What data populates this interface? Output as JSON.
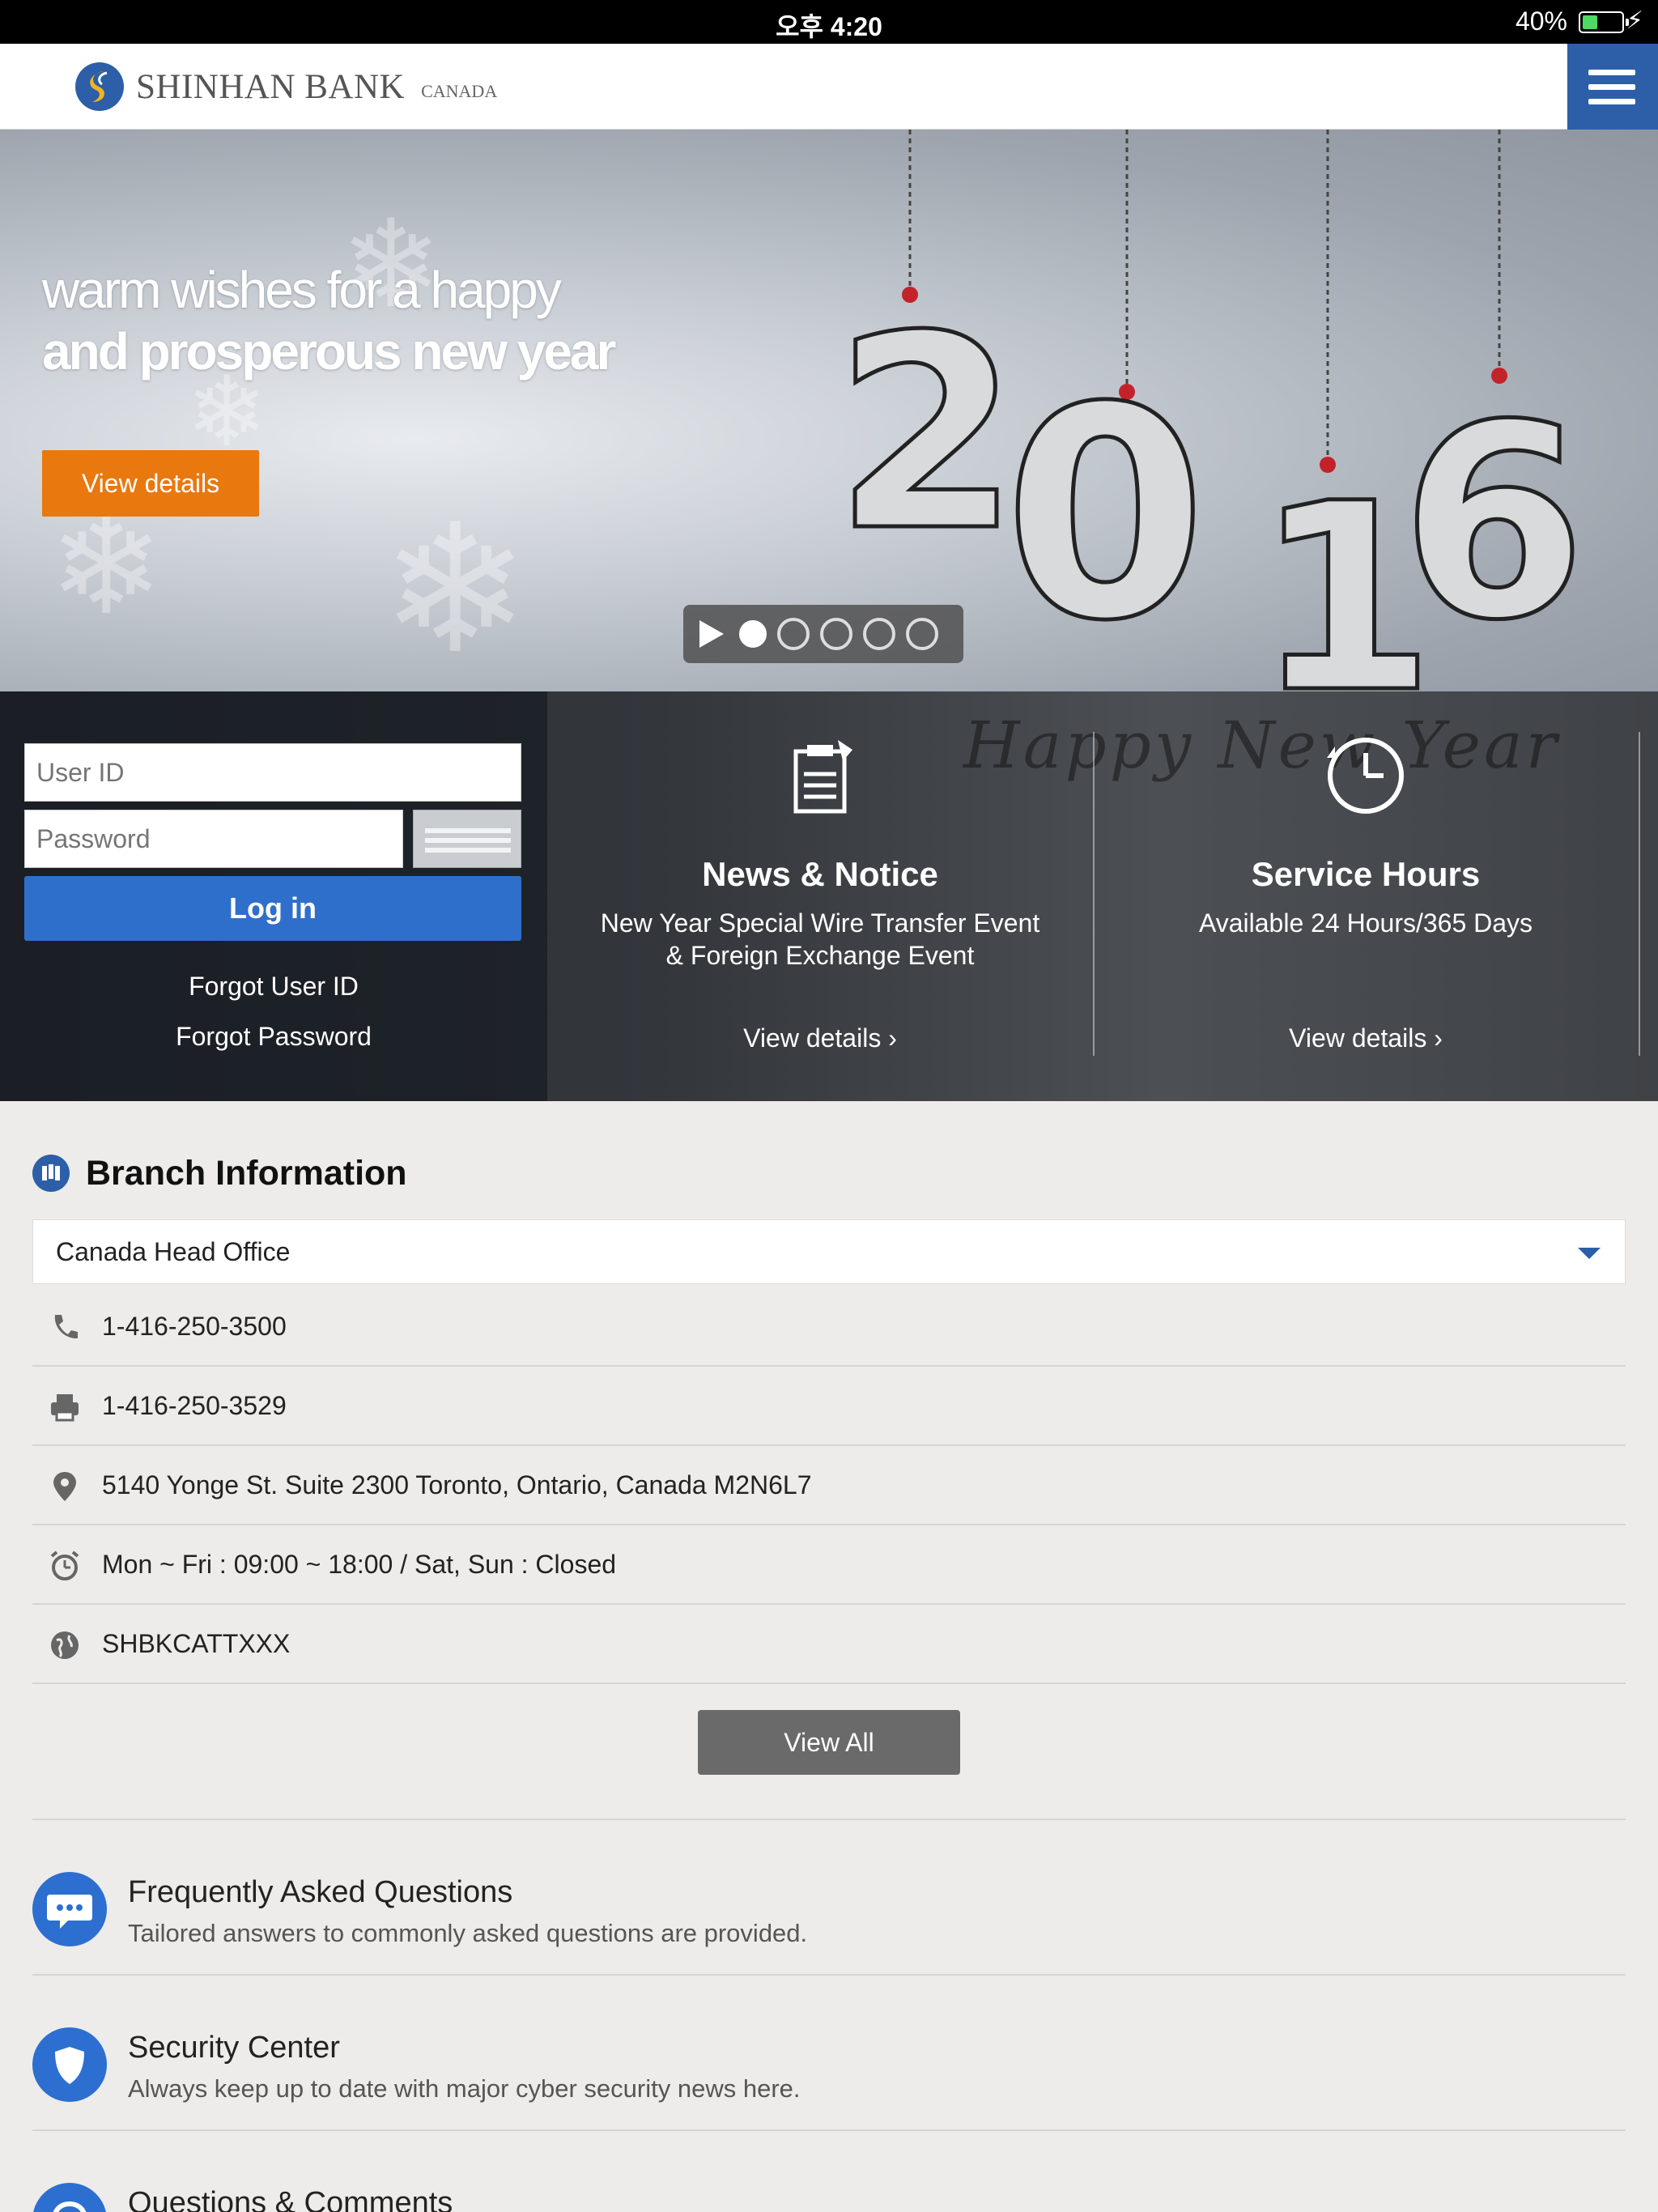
{
  "status_bar": {
    "time": "오후 4:20",
    "battery": "40%",
    "battery_level": 0.4
  },
  "header": {
    "brand": "SHINHAN BANK",
    "brand_suffix": "CANADA",
    "menu_icon": "hamburger-menu-icon"
  },
  "hero": {
    "line1": "warm wishes for a happy",
    "line2": "and prosperous new year",
    "button": "View details",
    "ornament_digits": [
      "2",
      "0",
      "1",
      "6"
    ],
    "slides": 5,
    "active_slide": 1
  },
  "login": {
    "user_placeholder": "User ID",
    "password_placeholder": "Password",
    "login_button": "Log in",
    "forgot_id": "Forgot User ID",
    "forgot_password": "Forgot Password"
  },
  "info_tiles": {
    "background_text": "Happy New Year",
    "news": {
      "title": "News & Notice",
      "line1": "New Year Special Wire Transfer Event",
      "line2": "& Foreign Exchange Event",
      "link": "View details",
      "icon": "clipboard-icon"
    },
    "hours": {
      "title": "Service Hours",
      "line1": "Available 24 Hours/365 Days",
      "link": "View details",
      "icon": "clock-icon"
    }
  },
  "branch": {
    "heading": "Branch Information",
    "selected": "Canada Head Office",
    "phone": "1-416-250-3500",
    "fax": "1-416-250-3529",
    "address": "5140 Yonge St. Suite 2300 Toronto, Ontario, Canada M2N6L7",
    "hours": "Mon ~ Fri : 09:00 ~ 18:00 / Sat, Sun : Closed",
    "swift": "SHBKCATTXXX",
    "view_all": "View All"
  },
  "features": [
    {
      "title": "Frequently Asked Questions",
      "desc": "Tailored answers to commonly asked questions are provided.",
      "icon": "chat-icon"
    },
    {
      "title": "Security Center",
      "desc": "Always keep up to date with major cyber security news here.",
      "icon": "shield-icon"
    },
    {
      "title": "Questions & Comments",
      "desc": "",
      "icon": "headset-icon"
    }
  ],
  "colors": {
    "brand_blue": "#2c5fa8",
    "login_blue": "#2f6fcc",
    "hero_orange": "#e9780f",
    "page_bg": "#edecea"
  }
}
